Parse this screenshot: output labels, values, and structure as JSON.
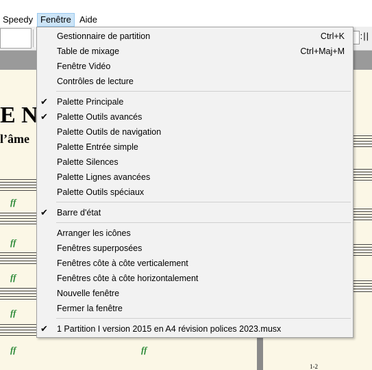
{
  "menubar": {
    "items": [
      {
        "label": "Speedy",
        "active": false
      },
      {
        "label": "Fenêtre",
        "active": true
      },
      {
        "label": "Aide",
        "active": false
      }
    ]
  },
  "toolbar": {
    "grip_label": ":||"
  },
  "score": {
    "title": "E N°",
    "subtitle": "l’âme",
    "dynamic": "ff",
    "page_label": "1-2"
  },
  "window_menu": {
    "groups": [
      [
        {
          "label": "Gestionnaire de partition",
          "shortcut": "Ctrl+K",
          "checked": false
        },
        {
          "label": "Table de mixage",
          "shortcut": "Ctrl+Maj+M",
          "checked": false
        },
        {
          "label": "Fenêtre Vidéo",
          "shortcut": "",
          "checked": false
        },
        {
          "label": "Contrôles de lecture",
          "shortcut": "",
          "checked": false
        }
      ],
      [
        {
          "label": "Palette Principale",
          "shortcut": "",
          "checked": true
        },
        {
          "label": "Palette Outils avancés",
          "shortcut": "",
          "checked": true
        },
        {
          "label": "Palette Outils de navigation",
          "shortcut": "",
          "checked": false
        },
        {
          "label": "Palette Entrée simple",
          "shortcut": "",
          "checked": false
        },
        {
          "label": "Palette Silences",
          "shortcut": "",
          "checked": false
        },
        {
          "label": "Palette Lignes avancées",
          "shortcut": "",
          "checked": false
        },
        {
          "label": "Palette Outils spéciaux",
          "shortcut": "",
          "checked": false
        }
      ],
      [
        {
          "label": "Barre d'état",
          "shortcut": "",
          "checked": true
        }
      ],
      [
        {
          "label": "Arranger les icônes",
          "shortcut": "",
          "checked": false
        },
        {
          "label": "Fenêtres superposées",
          "shortcut": "",
          "checked": false
        },
        {
          "label": "Fenêtres côte à côte verticalement",
          "shortcut": "",
          "checked": false
        },
        {
          "label": "Fenêtres côte à côte horizontalement",
          "shortcut": "",
          "checked": false
        },
        {
          "label": "Nouvelle fenêtre",
          "shortcut": "",
          "checked": false
        },
        {
          "label": "Fermer la fenêtre",
          "shortcut": "",
          "checked": false
        }
      ],
      [
        {
          "label": "1 Partition I version 2015 en A4 révision polices 2023.musx",
          "shortcut": "",
          "checked": true
        }
      ]
    ],
    "check_glyph": "✔"
  }
}
